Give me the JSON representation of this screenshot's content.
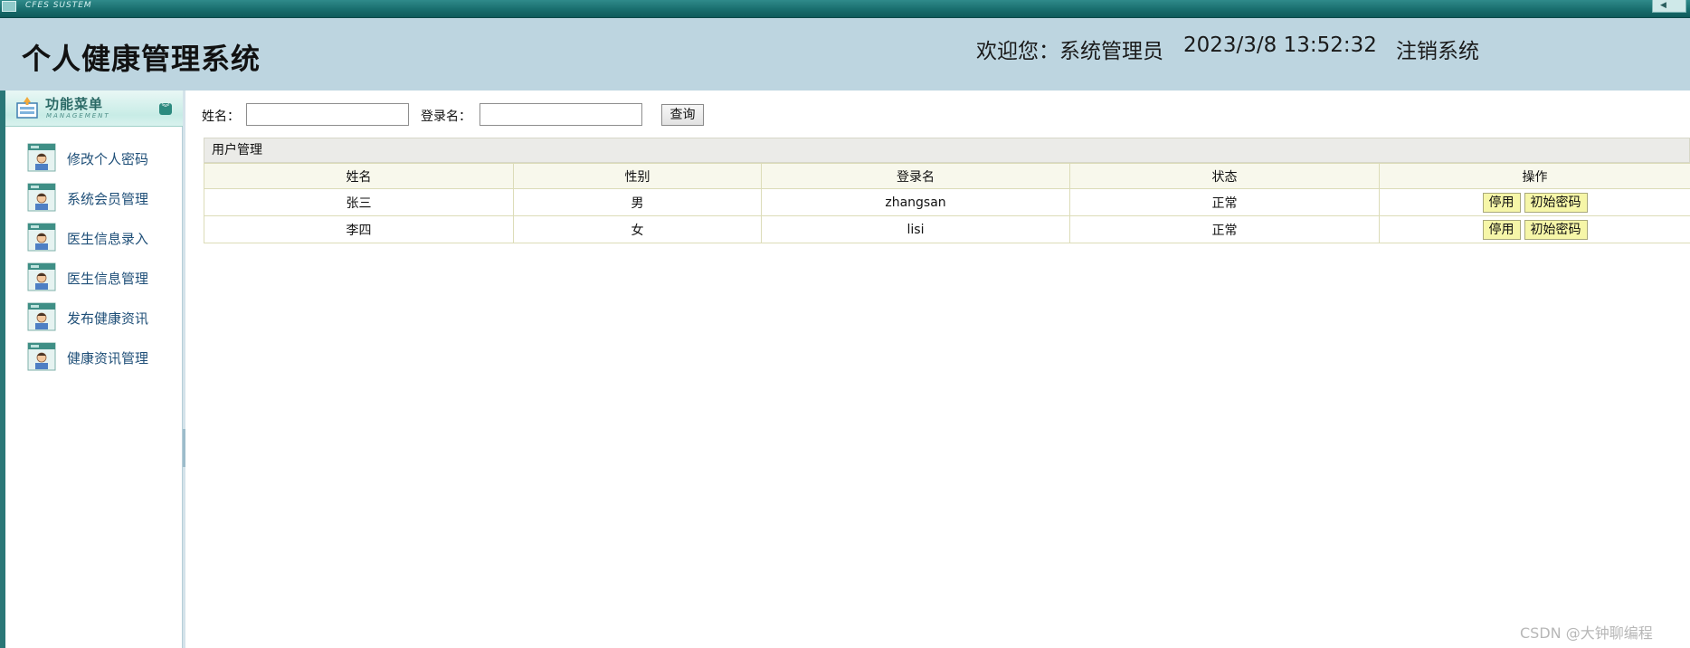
{
  "system_bar": {
    "title": "CFES SUSTEM",
    "right_button": "◀"
  },
  "header": {
    "app_title": "个人健康管理系统",
    "welcome": "欢迎您：系统管理员",
    "datetime": "2023/3/8 13:52:32",
    "logout": "注销系统"
  },
  "sidebar": {
    "head_title": "功能菜单",
    "head_subtitle": "MANAGEMENT",
    "items": [
      {
        "label": "修改个人密码"
      },
      {
        "label": "系统会员管理"
      },
      {
        "label": "医生信息录入"
      },
      {
        "label": "医生信息管理"
      },
      {
        "label": "发布健康资讯"
      },
      {
        "label": "健康资讯管理"
      }
    ]
  },
  "search": {
    "name_label": "姓名：",
    "name_value": "",
    "login_label": "登录名：",
    "login_value": "",
    "query_button": "查询"
  },
  "panel": {
    "title": "用户管理",
    "columns": [
      "姓名",
      "性别",
      "登录名",
      "状态",
      "操作"
    ],
    "rows": [
      {
        "name": "张三",
        "gender": "男",
        "login": "zhangsan",
        "status": "正常",
        "btn_disable": "停用",
        "btn_reset": "初始密码"
      },
      {
        "name": "李四",
        "gender": "女",
        "login": "lisi",
        "status": "正常",
        "btn_disable": "停用",
        "btn_reset": "初始密码"
      }
    ]
  },
  "watermark": "CSDN @大钟聊编程",
  "colors": {
    "header_bg": "#bdd5e0",
    "system_bar": "#176b6b",
    "menu_text": "#1f4f78",
    "op_button_bg": "#f6f6a8",
    "table_border": "#dcdcb8"
  }
}
